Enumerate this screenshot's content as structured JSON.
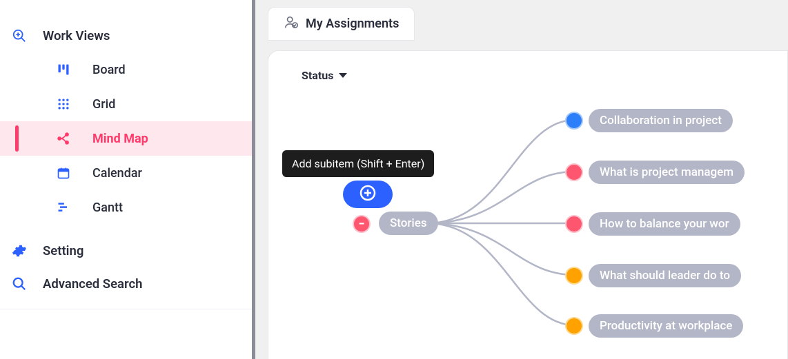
{
  "sidebar": {
    "header": "Work Views",
    "views": [
      {
        "label": "Board"
      },
      {
        "label": "Grid"
      },
      {
        "label": "Mind Map",
        "active": true
      },
      {
        "label": "Calendar"
      },
      {
        "label": "Gantt"
      }
    ],
    "setting_label": "Setting",
    "search_label": "Advanced Search"
  },
  "tab": {
    "label": "My Assignments"
  },
  "status": {
    "label": "Status"
  },
  "tooltip": {
    "text": "Add subitem (Shift + Enter)"
  },
  "mindmap": {
    "root": {
      "label": "Stories"
    },
    "children": [
      {
        "label": "Collaboration in project",
        "color": "blue"
      },
      {
        "label": "What is project managem",
        "color": "red"
      },
      {
        "label": "How to balance your wor",
        "color": "red"
      },
      {
        "label": "What should leader do to",
        "color": "orange"
      },
      {
        "label": "Productivity at workplace",
        "color": "orange"
      }
    ]
  }
}
